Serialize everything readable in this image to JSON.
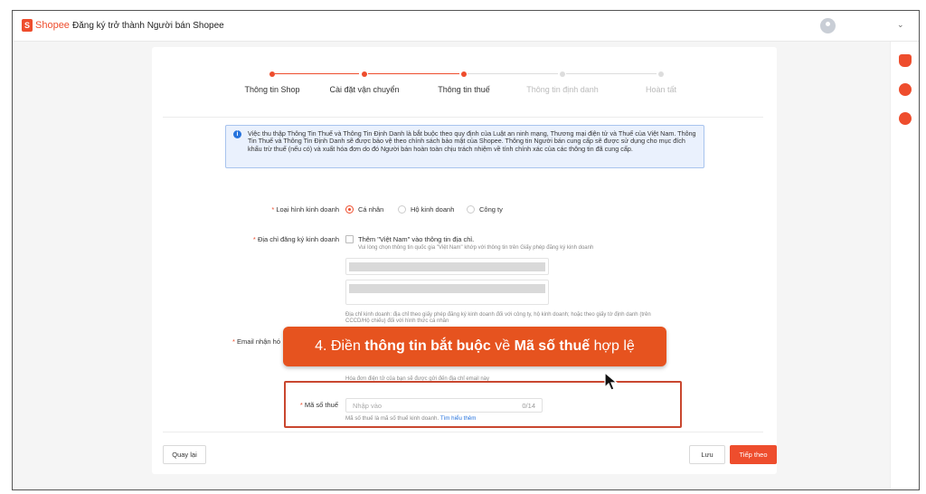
{
  "topbar": {
    "logo_glyph": "S",
    "logo_text": "Shopee",
    "title": "Đăng ký trở thành Người bán Shopee",
    "chevron": "⌄"
  },
  "colors": {
    "brand": "#ee4d2d",
    "callout": "#e6531f",
    "info": "#2673dd"
  },
  "steps": [
    {
      "label": "Thông tin Shop",
      "state": "done"
    },
    {
      "label": "Cài đặt vận chuyển",
      "state": "done"
    },
    {
      "label": "Thông tin thuế",
      "state": "active"
    },
    {
      "label": "Thông tin định danh",
      "state": "pending"
    },
    {
      "label": "Hoàn tất",
      "state": "pending"
    }
  ],
  "notice": {
    "icon": "i",
    "text": "Việc thu thập Thông Tin Thuế và Thông Tin Định Danh là bắt buộc theo quy định của Luật an ninh mạng, Thương mại điện tử và Thuế của Việt Nam. Thông Tin Thuế và Thông Tin Định Danh sẽ được bảo vệ theo chính sách bảo mật của Shopee. Thông tin Người bán cung cấp sẽ được sử dụng cho mục đích khấu trừ thuế (nếu có) và xuất hóa đơn do đó Người bán hoàn toàn chịu trách nhiệm về tính chính xác của các thông tin đã cung cấp."
  },
  "form": {
    "business_type": {
      "label": "Loại hình kinh doanh",
      "options": [
        "Cá nhân",
        "Hộ kinh doanh",
        "Công ty"
      ],
      "selected": "Cá nhân"
    },
    "address": {
      "label": "Địa chỉ đăng ký kinh doanh",
      "checkbox_label": "Thêm \"Việt Nam\" vào thông tin địa chỉ.",
      "checkbox_hint": "Vui lòng chọn thông tin quốc gia \"Việt Nam\" khớp với thông tin trên Giấy phép đăng ký kinh doanh",
      "footer_hint": "Địa chỉ kinh doanh: địa chỉ theo giấy phép đăng ký kinh doanh đối với công ty, hộ kinh doanh; hoặc theo giấy tờ định danh (trên CCCD/Hộ chiếu) đối với hình thức cá nhân"
    },
    "email": {
      "label": "Email nhận hó",
      "hint": "Hóa đơn điện tử của bạn sẽ được gửi đến địa chỉ email này"
    },
    "tax": {
      "label": "Mã số thuế",
      "placeholder": "Nhập vào",
      "counter": "0/14",
      "hint": "Mã số thuế là mã số thuế kinh doanh.",
      "link": "Tìm hiểu thêm"
    }
  },
  "buttons": {
    "back": "Quay lại",
    "save": "Lưu",
    "next": "Tiếp theo"
  },
  "callout": {
    "prefix": "4. Điền ",
    "bold1": "thông tin bắt buộc",
    "mid": " về ",
    "bold2": "Mã số thuế",
    "suffix": " hợp lệ"
  }
}
